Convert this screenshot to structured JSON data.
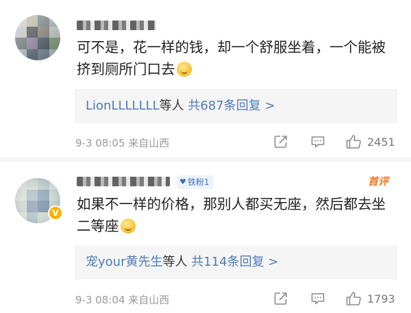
{
  "comments": [
    {
      "text": "可不是，花一样的钱，却一个舒服坐着，一个能被挤到厕所门口去",
      "emoji": "smile-face",
      "reply_users": "LionLLLLLLL",
      "reply_suffix": "等人",
      "reply_count_text": "共687条回复 >",
      "time": "9-3 08:05",
      "location": "来自山西",
      "like_count": "2451"
    },
    {
      "fan_badge": "铁粉1",
      "hot_tag": "首评",
      "text": "如果不一样的价格，那别人都买无座，然后都去坐二等座",
      "emoji": "laugh-cry-face",
      "reply_users": "宠your黄先生",
      "reply_suffix": "等人",
      "reply_count_text": "共114条回复 >",
      "time": "9-3 08:04",
      "location": "来自山西",
      "like_count": "1793",
      "verified_badge": "V"
    }
  ]
}
